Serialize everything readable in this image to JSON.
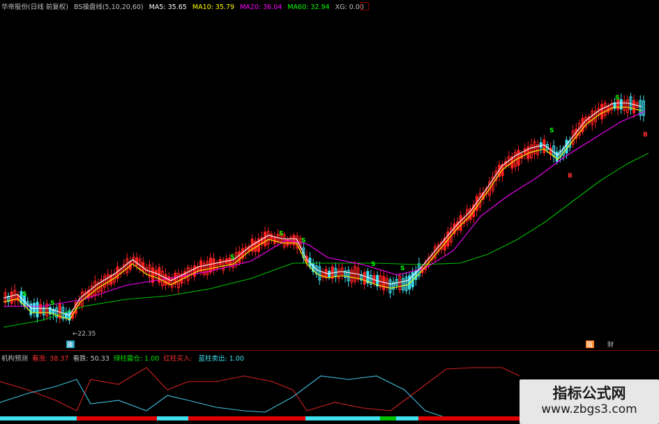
{
  "header": {
    "stock": "华帝股份(日线 前复权)",
    "indicator": "BS操盘线(5,10,20,60)",
    "ma5": "MA5: 35.65",
    "ma10": "MA10: 35.79",
    "ma20": "MA20: 36.04",
    "ma60": "MA60: 32.94",
    "xg": "XG: 0.00",
    "colors": {
      "stock": "#c0c0c0",
      "ma5": "#ffffff",
      "ma10": "#ffff00",
      "ma20": "#ff00ff",
      "ma60": "#00ff00",
      "xg": "#c0c0c0"
    }
  },
  "main_chart": {
    "low_marker": "←22.35",
    "signal_buy": "B",
    "signal_sell": "S",
    "tag_bottom_left": "藤",
    "tag_bottom_right1": "酶",
    "tag_bottom_right2": "财"
  },
  "lower_panel": {
    "name": "机构预测",
    "bull_label": "看涨:",
    "bull_value": "38.37",
    "bear_label": "看跌:",
    "bear_value": "50.33",
    "green_label": "绿柱震仓:",
    "green_value": "1.00",
    "red_label": "红柱买入:",
    "red_value": "",
    "blue_label": "蓝柱卖出:",
    "blue_value": "1.00"
  },
  "watermark": {
    "title": "指标公式网",
    "url": "www.zbgs3.com"
  }
}
